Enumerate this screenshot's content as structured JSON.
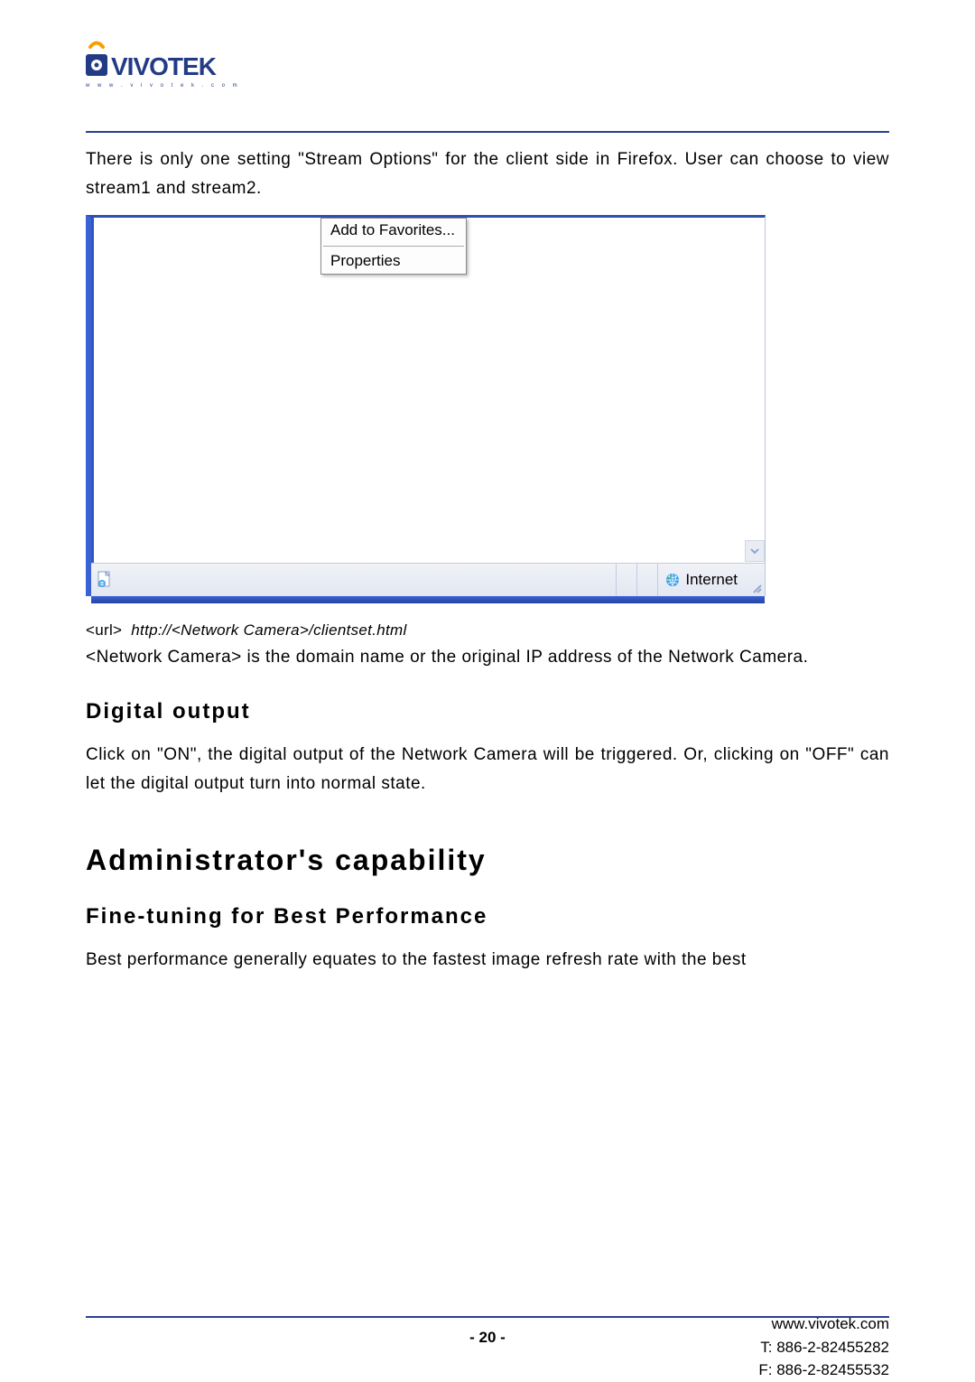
{
  "logo": {
    "tagline": "www.vivotek.com"
  },
  "intro_paragraph": "There is only one setting \"Stream Options\" for the client side in Firefox. User can choose to view stream1 and stream2.",
  "context_menu": {
    "add_favorites": "Add to Favorites...",
    "properties": "Properties"
  },
  "status_bar": {
    "zone": "Internet"
  },
  "url_line": {
    "prefix": "<url>",
    "italic": "http://<Network Camera>/clientset.html"
  },
  "camera_note": "<Network Camera> is the domain name or the original IP address of the Network Camera.",
  "digital_output": {
    "heading": "Digital output",
    "body": "Click on \"ON\", the digital output of the Network Camera will be triggered. Or, clicking on \"OFF\" can let the digital output turn into normal state."
  },
  "admin": {
    "heading": "Administrator's capability",
    "subheading": "Fine-tuning for Best Performance",
    "body": "Best performance generally equates to the fastest image refresh rate with the best"
  },
  "footer": {
    "page_number": "- 20 -",
    "website": "www.vivotek.com",
    "tel": "T: 886-2-82455282",
    "fax": "F: 886-2-82455532"
  }
}
